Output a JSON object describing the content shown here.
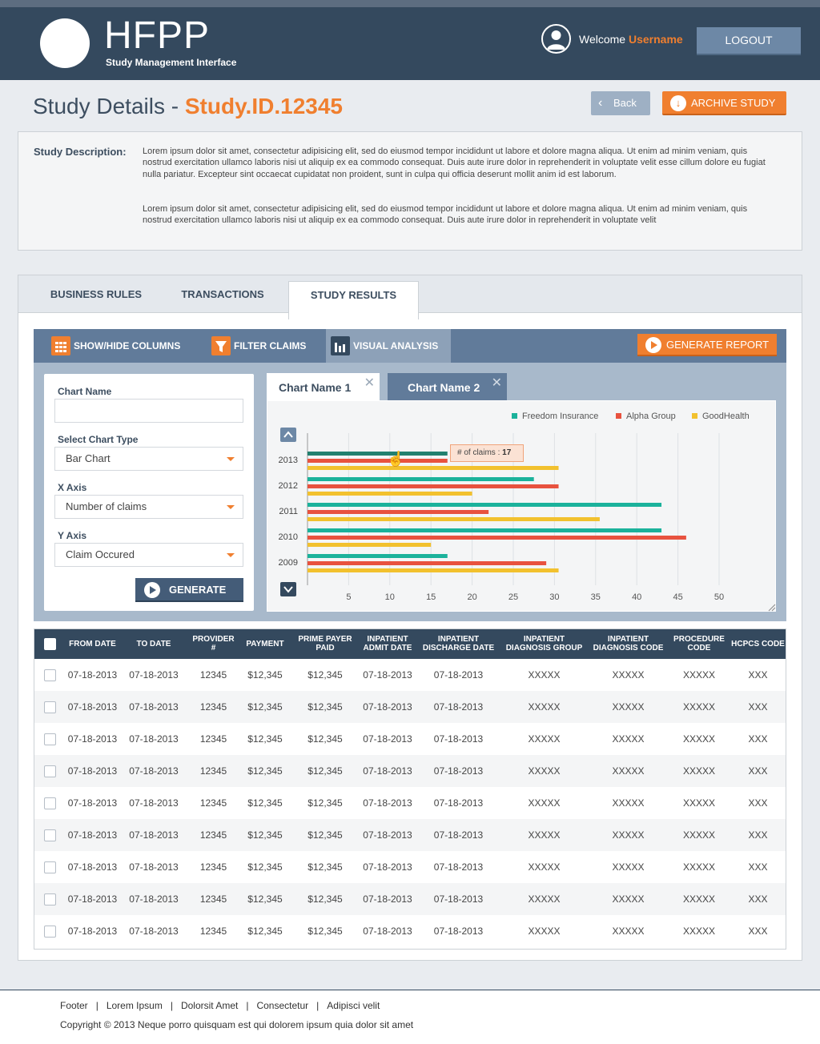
{
  "header": {
    "logo_title": "HFPP",
    "logo_subtitle": "Study Management Interface",
    "welcome_text": "Welcome",
    "username": "Username",
    "logout_label": "LOGOUT"
  },
  "page": {
    "title_prefix": "Study Details - ",
    "study_id": "Study.ID.12345",
    "back_label": "Back",
    "archive_label": "ARCHIVE STUDY"
  },
  "description": {
    "label": "Study Description:",
    "paragraph1": "Lorem ipsum dolor sit amet, consectetur adipisicing elit, sed do eiusmod tempor incididunt ut labore et dolore magna aliqua. Ut enim ad minim veniam, quis nostrud exercitation ullamco laboris nisi ut aliquip ex ea commodo consequat. Duis aute irure dolor in reprehenderit in voluptate velit esse cillum dolore eu fugiat nulla pariatur. Excepteur sint occaecat cupidatat non proident, sunt in culpa qui officia deserunt mollit anim id est laborum.",
    "paragraph2": "Lorem ipsum dolor sit amet, consectetur adipisicing elit, sed do eiusmod tempor incididunt ut labore et dolore magna aliqua. Ut enim ad minim veniam, quis nostrud exercitation ullamco laboris nisi ut aliquip ex ea commodo consequat. Duis aute irure dolor in reprehenderit in voluptate velit"
  },
  "tabs": [
    "BUSINESS RULES",
    "TRANSACTIONS",
    "STUDY RESULTS"
  ],
  "active_tab": "STUDY RESULTS",
  "toolbar": {
    "show_hide": "SHOW/HIDE COLUMNS",
    "filter": "FILTER CLAIMS",
    "visual": "VISUAL ANALYSIS",
    "generate_report": "GENERATE REPORT"
  },
  "form": {
    "chart_name_label": "Chart Name",
    "chart_name_value": "",
    "chart_type_label": "Select Chart Type",
    "chart_type_value": "Bar Chart",
    "x_axis_label": "X Axis",
    "x_axis_value": "Number of claims",
    "y_axis_label": "Y Axis",
    "y_axis_value": "Claim Occured",
    "generate_label": "GENERATE"
  },
  "chart_tabs": [
    "Chart Name 1",
    "Chart Name 2"
  ],
  "tooltip": {
    "label": "# of  claims :",
    "value": "17"
  },
  "colors": {
    "freedom": "#1bb29b",
    "alpha": "#e8523f",
    "goodhealth": "#f2c12e",
    "accent": "#f07f2f",
    "header": "#34495e"
  },
  "chart_data": {
    "type": "bar",
    "orientation": "horizontal",
    "categories": [
      "2013",
      "2012",
      "2011",
      "2010",
      "2009"
    ],
    "series": [
      {
        "name": "Freedom Insurance",
        "values": [
          17,
          27.5,
          43,
          43,
          17
        ]
      },
      {
        "name": "Alpha Group",
        "values": [
          17,
          30.5,
          22,
          46,
          29
        ]
      },
      {
        "name": "GoodHealth",
        "values": [
          30.5,
          20,
          35.5,
          15,
          30.5
        ]
      }
    ],
    "x_ticks": [
      5,
      10,
      15,
      20,
      25,
      30,
      35,
      40,
      45,
      50
    ],
    "xlim": [
      0,
      55
    ],
    "grid": true,
    "legend_position": "top-right"
  },
  "table": {
    "columns": [
      "FROM DATE",
      "TO DATE",
      "PROVIDER #",
      "PAYMENT",
      "PRIME PAYER PAID",
      "INPATIENT ADMIT DATE",
      "INPATIENT DISCHARGE DATE",
      "INPATIENT DIAGNOSIS GROUP",
      "INPATIENT DIAGNOSIS CODE",
      "PROCEDURE CODE",
      "HCPCS CODE"
    ],
    "rows": [
      [
        "07-18-2013",
        "07-18-2013",
        "12345",
        "$12,345",
        "$12,345",
        "07-18-2013",
        "07-18-2013",
        "XXXXX",
        "XXXXX",
        "XXXXX",
        "XXX"
      ],
      [
        "07-18-2013",
        "07-18-2013",
        "12345",
        "$12,345",
        "$12,345",
        "07-18-2013",
        "07-18-2013",
        "XXXXX",
        "XXXXX",
        "XXXXX",
        "XXX"
      ],
      [
        "07-18-2013",
        "07-18-2013",
        "12345",
        "$12,345",
        "$12,345",
        "07-18-2013",
        "07-18-2013",
        "XXXXX",
        "XXXXX",
        "XXXXX",
        "XXX"
      ],
      [
        "07-18-2013",
        "07-18-2013",
        "12345",
        "$12,345",
        "$12,345",
        "07-18-2013",
        "07-18-2013",
        "XXXXX",
        "XXXXX",
        "XXXXX",
        "XXX"
      ],
      [
        "07-18-2013",
        "07-18-2013",
        "12345",
        "$12,345",
        "$12,345",
        "07-18-2013",
        "07-18-2013",
        "XXXXX",
        "XXXXX",
        "XXXXX",
        "XXX"
      ],
      [
        "07-18-2013",
        "07-18-2013",
        "12345",
        "$12,345",
        "$12,345",
        "07-18-2013",
        "07-18-2013",
        "XXXXX",
        "XXXXX",
        "XXXXX",
        "XXX"
      ],
      [
        "07-18-2013",
        "07-18-2013",
        "12345",
        "$12,345",
        "$12,345",
        "07-18-2013",
        "07-18-2013",
        "XXXXX",
        "XXXXX",
        "XXXXX",
        "XXX"
      ],
      [
        "07-18-2013",
        "07-18-2013",
        "12345",
        "$12,345",
        "$12,345",
        "07-18-2013",
        "07-18-2013",
        "XXXXX",
        "XXXXX",
        "XXXXX",
        "XXX"
      ],
      [
        "07-18-2013",
        "07-18-2013",
        "12345",
        "$12,345",
        "$12,345",
        "07-18-2013",
        "07-18-2013",
        "XXXXX",
        "XXXXX",
        "XXXXX",
        "XXX"
      ]
    ]
  },
  "footer": {
    "links": [
      "Footer",
      "Lorem Ipsum",
      "Dolorsit Amet",
      "Consectetur",
      "Adipisci velit"
    ],
    "copyright": "Copyright © 2013 Neque porro quisquam est qui dolorem ipsum quia dolor sit amet"
  }
}
